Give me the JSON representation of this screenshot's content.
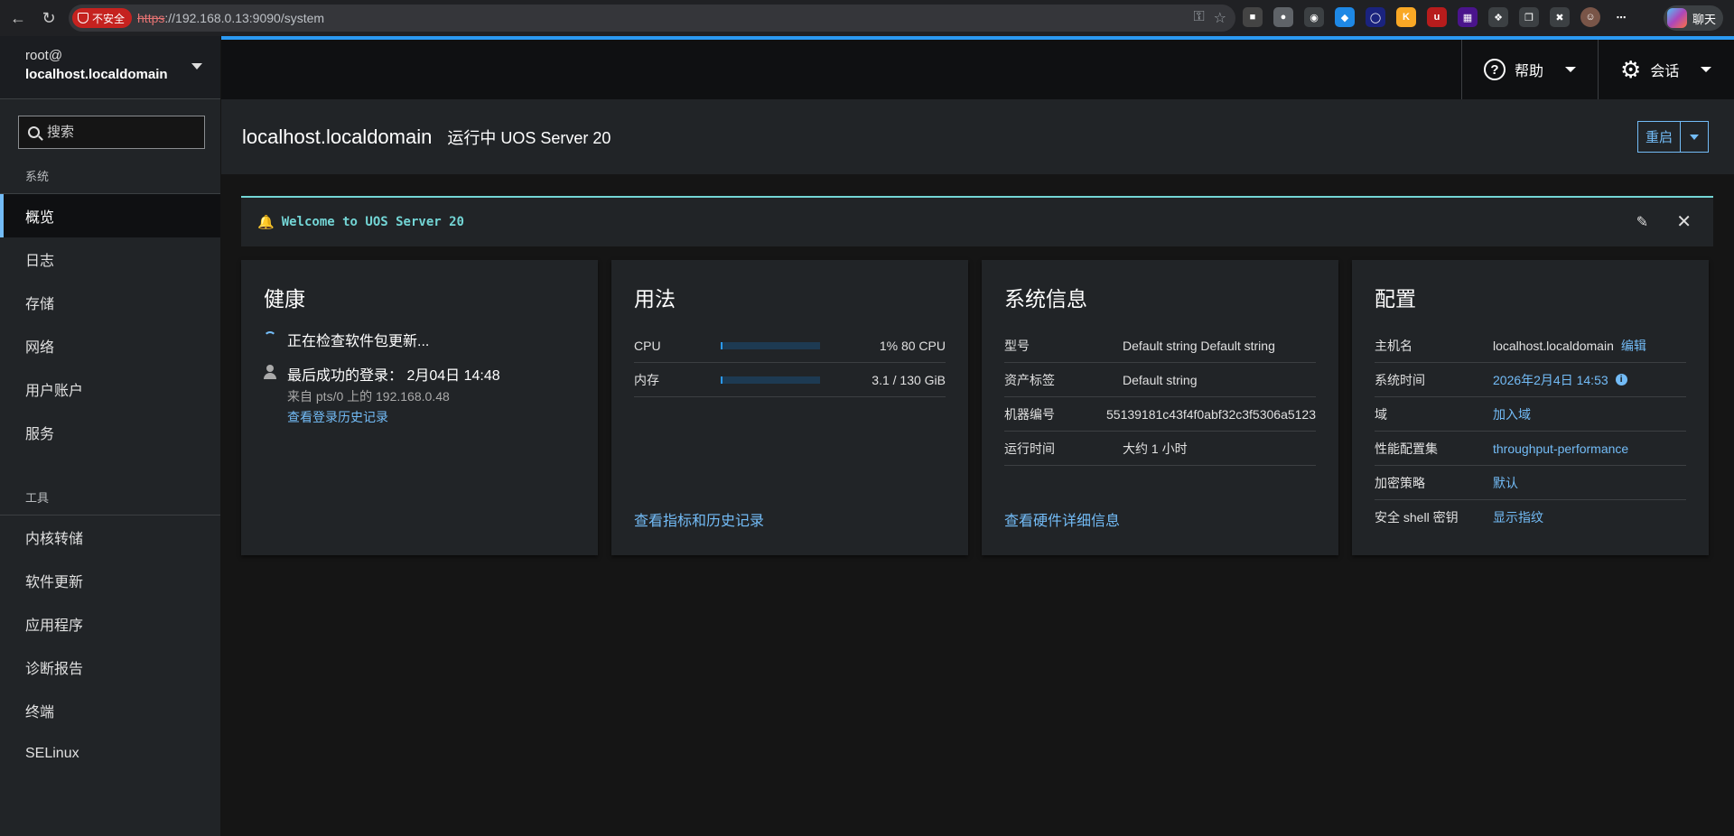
{
  "browser": {
    "insecure_label": "不安全",
    "url_scheme": "https",
    "url_rest": "://192.168.0.13:9090/system",
    "chat_label": "聊天"
  },
  "sidebar": {
    "user": "root@",
    "host": "localhost.localdomain",
    "search_placeholder": "搜索",
    "section_system": "系统",
    "system_items": [
      {
        "label": "概览"
      },
      {
        "label": "日志"
      },
      {
        "label": "存储"
      },
      {
        "label": "网络"
      },
      {
        "label": "用户账户"
      },
      {
        "label": "服务"
      }
    ],
    "section_tools": "工具",
    "tool_items": [
      {
        "label": "内核转储"
      },
      {
        "label": "软件更新"
      },
      {
        "label": "应用程序"
      },
      {
        "label": "诊断报告"
      },
      {
        "label": "终端"
      },
      {
        "label": "SELinux"
      }
    ]
  },
  "topbar": {
    "help_label": "帮助",
    "session_label": "会话"
  },
  "header": {
    "hostname": "localhost.localdomain",
    "status": "运行中 UOS Server 20",
    "restart_label": "重启"
  },
  "banner": {
    "text": "Welcome to UOS Server 20"
  },
  "health": {
    "title": "健康",
    "checking": "正在检查软件包更新...",
    "last_login_label": "最后成功的登录：",
    "last_login_time": "2月04日 14:48",
    "from": "来自 pts/0 上的 192.168.0.48",
    "history_link": "查看登录历史记录"
  },
  "usage": {
    "title": "用法",
    "rows": [
      {
        "label": "CPU",
        "value": "1% 80 CPU",
        "fraction": 0.01
      },
      {
        "label": "内存",
        "value": "3.1 / 130 GiB",
        "fraction": 0.024
      }
    ],
    "link": "查看指标和历史记录"
  },
  "sysinfo": {
    "title": "系统信息",
    "rows": [
      {
        "label": "型号",
        "value": "Default string Default string"
      },
      {
        "label": "资产标签",
        "value": "Default string"
      },
      {
        "label": "机器编号",
        "value": "55139181c43f4f0abf32c3f5306a5123"
      },
      {
        "label": "运行时间",
        "value": "大约 1 小时"
      }
    ],
    "link": "查看硬件详细信息"
  },
  "config": {
    "title": "配置",
    "hostname_label": "主机名",
    "hostname_value": "localhost.localdomain",
    "hostname_edit": "编辑",
    "time_label": "系统时间",
    "time_value": "2026年2月4日 14:53",
    "domain_label": "域",
    "domain_value": "加入域",
    "profile_label": "性能配置集",
    "profile_value": "throughput-performance",
    "crypto_label": "加密策略",
    "crypto_value": "默认",
    "ssh_label": "安全 shell 密钥",
    "ssh_value": "显示指纹"
  }
}
